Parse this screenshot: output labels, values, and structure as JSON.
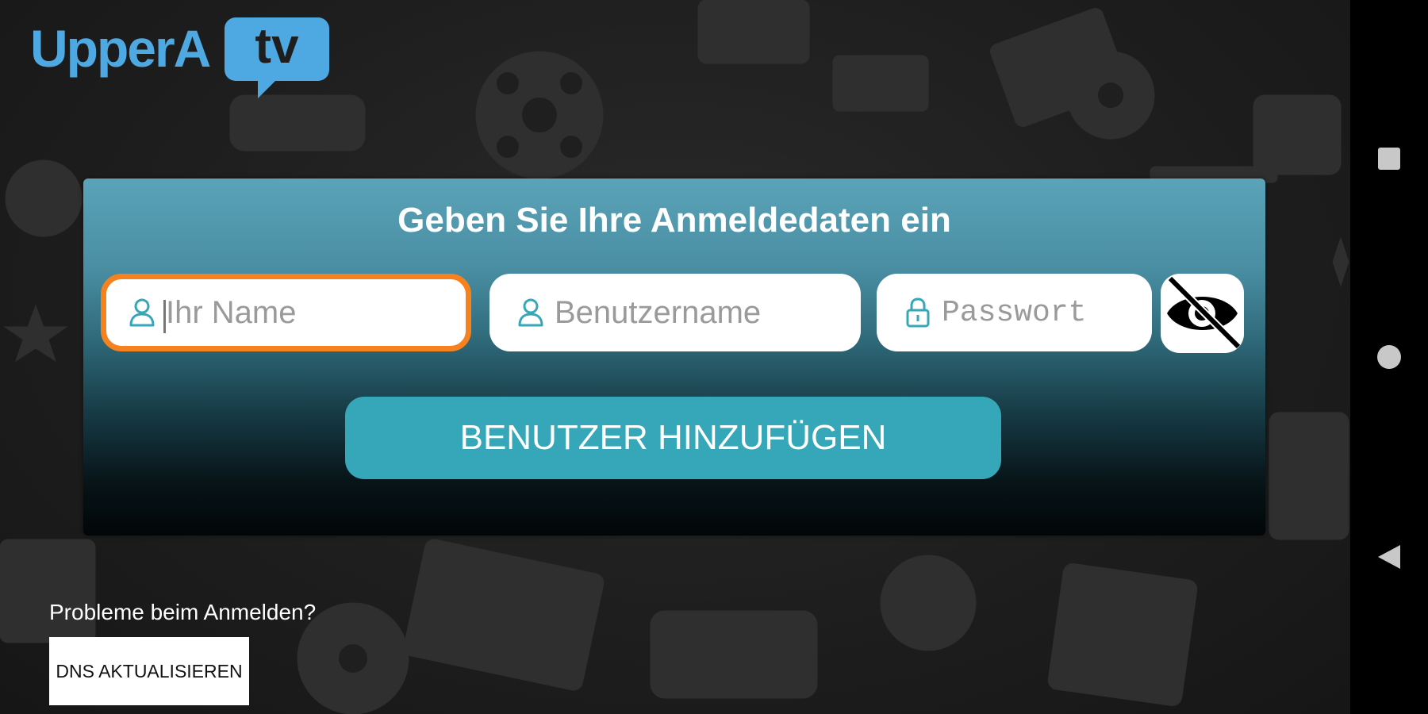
{
  "logo": {
    "text_main": "UpperA",
    "text_bubble": "tv"
  },
  "login": {
    "title": "Geben Sie Ihre Anmeldedaten ein",
    "name_field": {
      "placeholder": "Ihr Name",
      "value": "",
      "icon": "person-icon"
    },
    "username_field": {
      "placeholder": "Benutzername",
      "value": "",
      "icon": "person-icon"
    },
    "password_field": {
      "placeholder": "Passwort",
      "value": "",
      "icon": "lock-icon"
    },
    "visibility_toggle": {
      "icon": "eye-off-icon"
    },
    "add_user_button": "BENUTZER HINZUFÜGEN"
  },
  "help": {
    "question": "Probleme beim Anmelden?",
    "dns_button": "DNS AKTUALISIEREN"
  },
  "system_nav": {
    "recents_icon": "square-icon",
    "home_icon": "circle-icon",
    "back_icon": "triangle-back-icon"
  },
  "colors": {
    "accent": "#35a7b8",
    "focus": "#f5821f",
    "logo": "#4ea9e3"
  }
}
